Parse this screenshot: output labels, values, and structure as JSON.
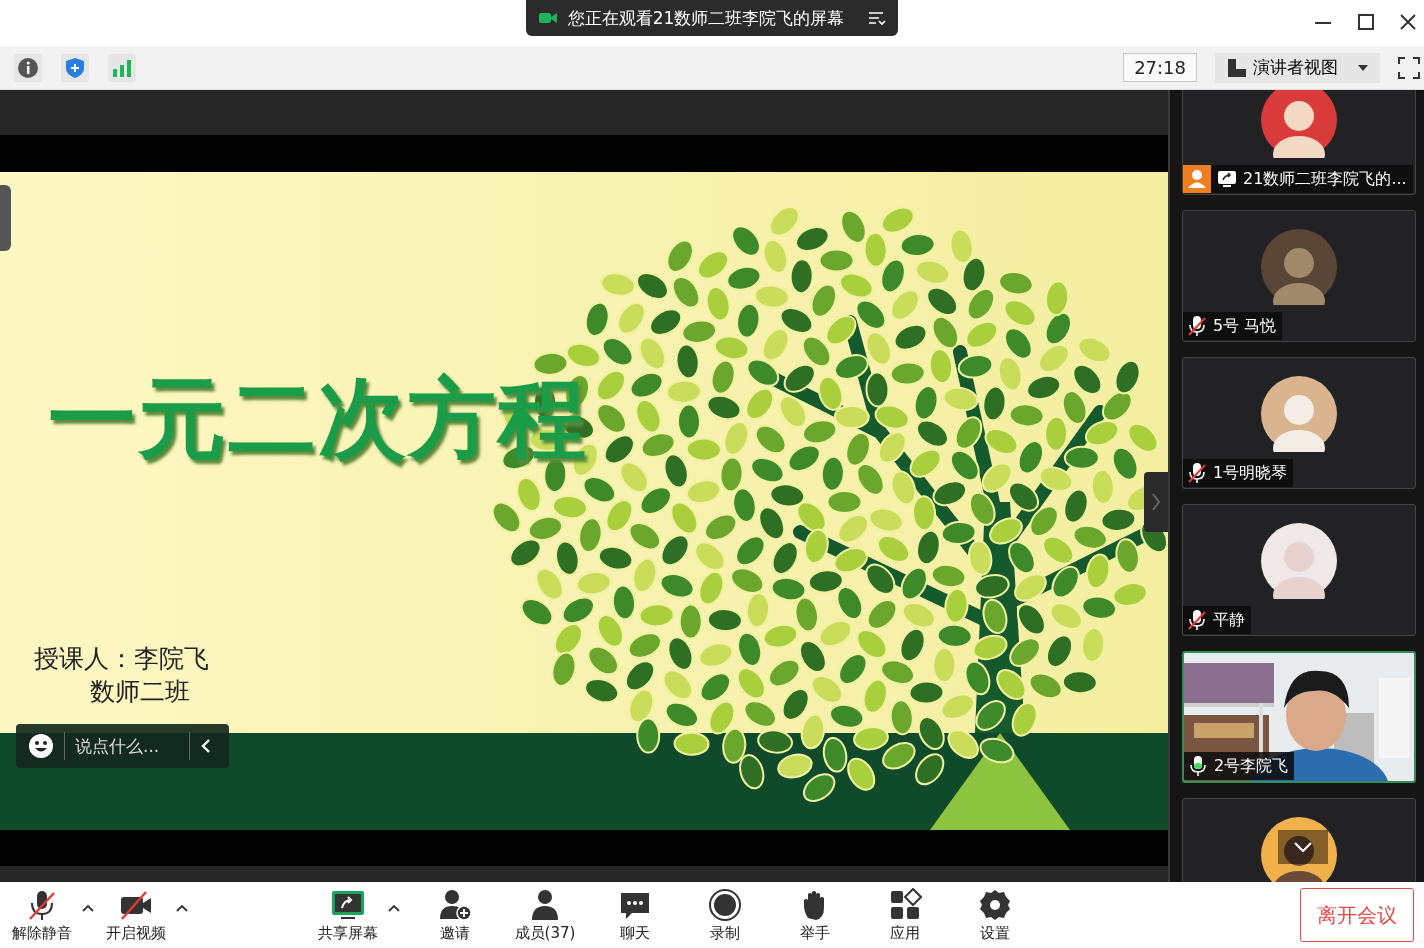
{
  "title_bar": {
    "notice": "您正在观看21数师二班李院飞的屏幕"
  },
  "toolbar": {
    "timer": "27:18",
    "view_button": "演讲者视图"
  },
  "slide": {
    "title": "一元二次方程",
    "lines": [
      "授课人：李院飞",
      "数师二班"
    ]
  },
  "chat": {
    "placeholder": "说点什么..."
  },
  "participants": [
    {
      "kind": "avatar",
      "name": "21数师二班李院飞的...",
      "sharing": true,
      "speaking": false
    },
    {
      "kind": "avatar",
      "name": "5号 马悦",
      "muted": true,
      "speaking": false
    },
    {
      "kind": "avatar",
      "name": "1号明晓琴",
      "muted": true,
      "speaking": false
    },
    {
      "kind": "avatar",
      "name": "平静",
      "muted": true,
      "speaking": false
    },
    {
      "kind": "video",
      "name": "2号李院飞",
      "muted": false,
      "speaking": true
    },
    {
      "kind": "avatar",
      "speaking": false
    }
  ],
  "controls": [
    {
      "kind": "mic-off",
      "label": "解除静音",
      "menu": true
    },
    {
      "kind": "camera-off",
      "label": "开启视频",
      "menu": true
    },
    {
      "kind": "share",
      "label": "共享屏幕",
      "menu": true
    },
    {
      "kind": "invite",
      "label": "邀请",
      "menu": false
    },
    {
      "kind": "members",
      "label": "成员(37)",
      "menu": false
    },
    {
      "kind": "chat",
      "label": "聊天",
      "menu": false
    },
    {
      "kind": "record",
      "label": "录制",
      "menu": false
    },
    {
      "kind": "hand",
      "label": "举手",
      "menu": false
    },
    {
      "kind": "apps",
      "label": "应用",
      "menu": false
    },
    {
      "kind": "settings",
      "label": "设置",
      "menu": false
    }
  ],
  "leave_button": "离开会议"
}
